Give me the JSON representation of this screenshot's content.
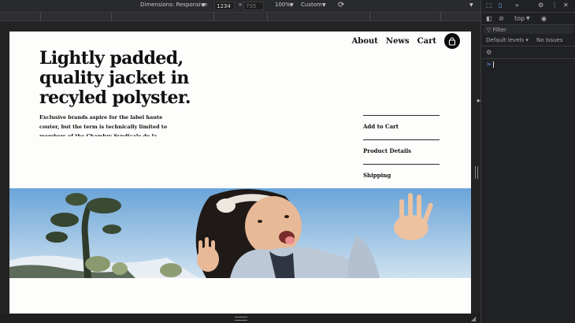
{
  "device_toolbar": {
    "dimensions_label": "Dimensions: Responsive",
    "width_value": "1234",
    "height_placeholder": "755",
    "x_separator": "×",
    "zoom": "100%",
    "throttle": "Custom",
    "caret": "▼"
  },
  "site": {
    "nav": [
      "About",
      "News",
      "Cart"
    ],
    "hero_title": "Lightly padded, quality jacket in recyled polyster.",
    "hero_copy": "Exclusive brands aspire for the label haute couter, but the term is technically limited to members of the Chambry Syndicale de la Haute",
    "side_links": [
      "Add to Cart",
      "Product Details",
      "Shipping"
    ]
  },
  "devtools": {
    "context": "top",
    "filter": "Filter",
    "levels": "Default levels ▾",
    "issues": "No Issues",
    "prompt": ">"
  },
  "colors": {
    "page_bg": "#fdfdfb",
    "devtools_bg": "#202124",
    "sky_top": "#6aa4d8",
    "sky_bottom": "#cfe2f0"
  }
}
